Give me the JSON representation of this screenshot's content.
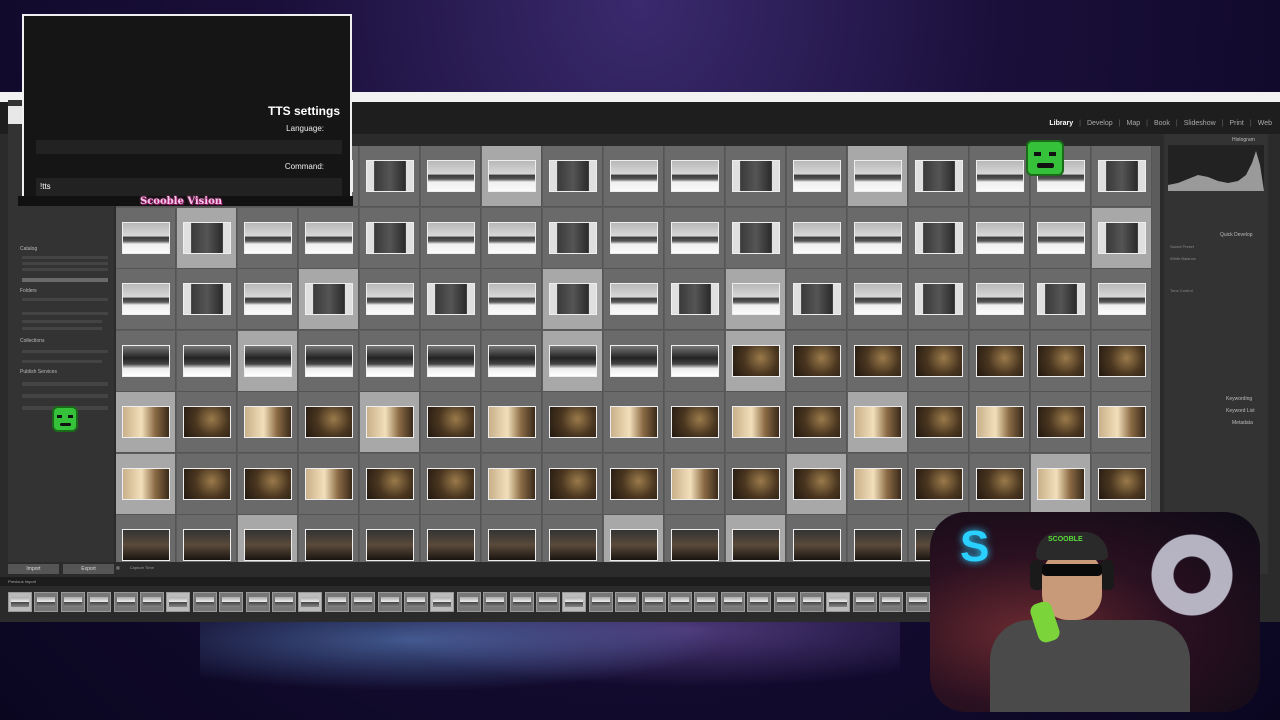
{
  "lightroom": {
    "modules": [
      "Library",
      "Develop",
      "Map",
      "Book",
      "Slideshow",
      "Print",
      "Web"
    ],
    "active_module": "Library",
    "left_panel": {
      "sections": [
        "Catalog",
        "Folders",
        "Collections",
        "Publish Services"
      ],
      "buttons": [
        "Import",
        "Export"
      ]
    },
    "right_panel": {
      "sections": [
        "Histogram",
        "Quick Develop",
        "Keywording",
        "Keyword List",
        "Metadata"
      ],
      "quick_develop_rows": [
        "Saved Preset",
        "White Balance",
        "Tone Control"
      ]
    },
    "filmstrip": {
      "source": "Previous Import"
    },
    "grid_status": {
      "sort_label": "Capture Time"
    }
  },
  "tts": {
    "title": "TTS settings",
    "language_label": "Language:",
    "command_label": "Command:",
    "command_value": "!tts"
  },
  "overlay": {
    "channel_label": "Scooble Vision",
    "cap_text": "SCOOBLE"
  },
  "colors": {
    "accent_green": "#35c23a",
    "lr_panel": "#333333",
    "grid_bg": "#5c5c5c",
    "label_pink": "#f4c6e8"
  }
}
